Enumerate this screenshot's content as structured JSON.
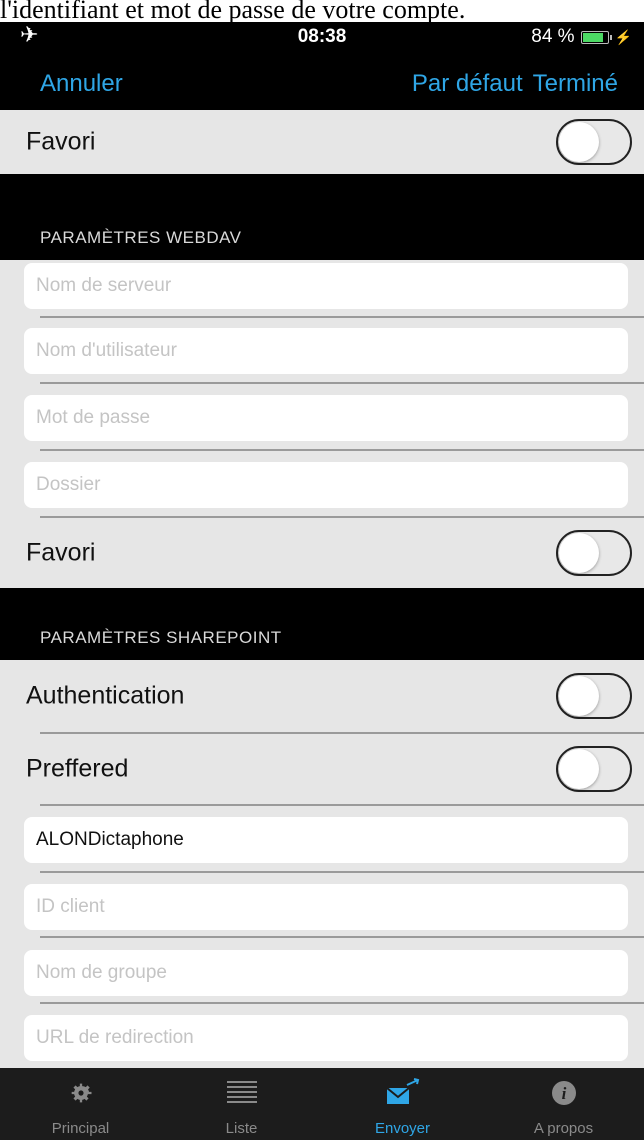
{
  "caption": "l'identifiant et mot de passe de votre compte.",
  "status": {
    "time": "08:38",
    "battery": "84 %",
    "battery_level": 0.84
  },
  "nav": {
    "cancel": "Annuler",
    "default": "Par défaut",
    "done": "Terminé"
  },
  "rows": {
    "favori_top": "Favori",
    "favori_webdav": "Favori",
    "authentication": "Authentication",
    "preffered": "Preffered"
  },
  "sections": {
    "webdav": "PARAMÈTRES WEBDAV",
    "sharepoint": "PARAMÈTRES SHAREPOINT"
  },
  "webdav": {
    "server": "Nom de serveur",
    "username": "Nom d'utilisateur",
    "password": "Mot de passe",
    "folder": "Dossier"
  },
  "sharepoint": {
    "app_name": "ALONDictaphone",
    "client_id": "ID client",
    "group": "Nom de groupe",
    "redirect_url": "URL de redirection"
  },
  "tabs": [
    {
      "label": "Principal",
      "icon": "gear-icon"
    },
    {
      "label": "Liste",
      "icon": "list-icon"
    },
    {
      "label": "Envoyer",
      "icon": "send-mail-icon",
      "active": true
    },
    {
      "label": "A propos",
      "icon": "info-icon"
    }
  ],
  "colors": {
    "accent": "#2fa6e6",
    "battery": "#4cd964"
  }
}
